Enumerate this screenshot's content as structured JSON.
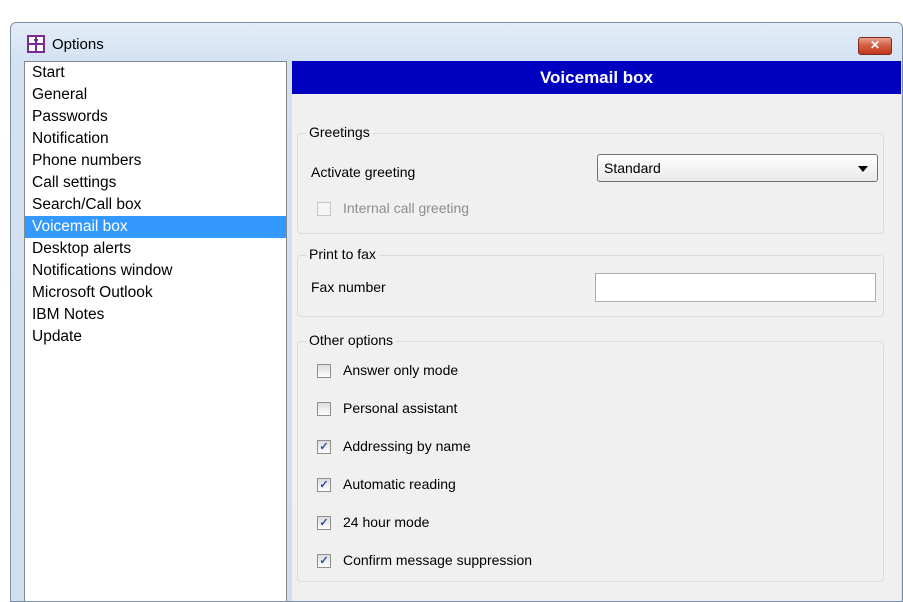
{
  "window": {
    "title": "Options",
    "close_glyph": "✕"
  },
  "nav": {
    "items": [
      "Start",
      "General",
      "Passwords",
      "Notification",
      "Phone numbers",
      "Call settings",
      "Search/Call box",
      "Voicemail box",
      "Desktop alerts",
      "Notifications window",
      "Microsoft Outlook",
      "IBM Notes",
      "Update"
    ],
    "selected": "Voicemail box"
  },
  "panel": {
    "title": "Voicemail box"
  },
  "greetings": {
    "legend": "Greetings",
    "activate_label": "Activate greeting",
    "activate_value": "Standard",
    "internal_label": "Internal call greeting"
  },
  "fax": {
    "legend": "Print to fax",
    "number_label": "Fax number",
    "number_value": ""
  },
  "other": {
    "legend": "Other options",
    "options": [
      {
        "label": "Answer only mode",
        "checked": false
      },
      {
        "label": "Personal assistant",
        "checked": false
      },
      {
        "label": "Addressing by name",
        "checked": true
      },
      {
        "label": "Automatic reading",
        "checked": true
      },
      {
        "label": "24 hour mode",
        "checked": true
      },
      {
        "label": "Confirm message suppression",
        "checked": true
      }
    ]
  },
  "colors": {
    "header_bg": "#0000c0",
    "selection_bg": "#3399ff",
    "check_mark": "#2a48a8"
  }
}
